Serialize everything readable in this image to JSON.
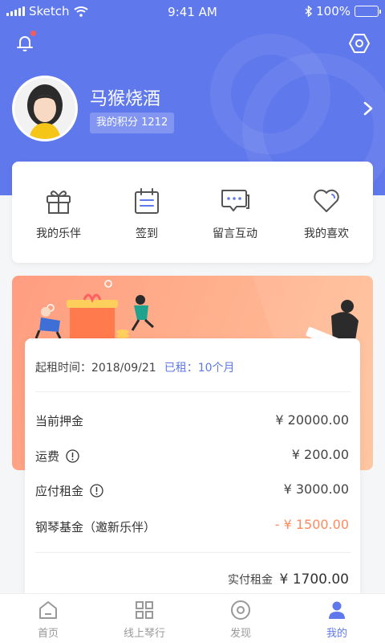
{
  "status_bar": {
    "carrier": "Sketch",
    "time": "9:41 AM",
    "battery": "100%"
  },
  "profile": {
    "name": "马猴烧酒",
    "points_label": "我的积分 1212"
  },
  "quick_actions": [
    {
      "label": "我的乐伴",
      "icon": "gift-icon"
    },
    {
      "label": "签到",
      "icon": "calendar-icon"
    },
    {
      "label": "留言互动",
      "icon": "chat-icon"
    },
    {
      "label": "我的喜欢",
      "icon": "heart-icon"
    }
  ],
  "rent": {
    "start_label": "起租时间：2018/09/21",
    "rented_label": "已租：10个月",
    "rows": [
      {
        "label": "当前押金",
        "value": "¥ 20000.00",
        "info": false
      },
      {
        "label": "运费",
        "value": "¥ 200.00",
        "info": true
      },
      {
        "label": "应付租金",
        "value": "¥ 3000.00",
        "info": true
      },
      {
        "label": "钢琴基金（邀新乐伴）",
        "value": "- ¥ 1500.00",
        "info": false
      }
    ],
    "total_label": "实付租金",
    "total_value": "¥ 1700.00"
  },
  "tabs": [
    {
      "label": "首页",
      "icon": "home-icon",
      "active": false
    },
    {
      "label": "线上琴行",
      "icon": "grid-icon",
      "active": false
    },
    {
      "label": "发现",
      "icon": "discover-icon",
      "active": false
    },
    {
      "label": "我的",
      "icon": "user-icon",
      "active": true
    }
  ],
  "colors": {
    "primary": "#5f78ec",
    "accent_orange": "#ff8a5c",
    "notification_dot": "#f25c5c"
  }
}
